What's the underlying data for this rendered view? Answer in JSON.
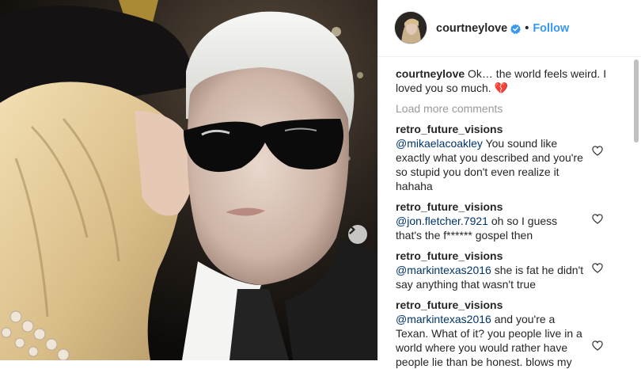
{
  "post": {
    "author": "courtneylove",
    "follow_label": "Follow",
    "separator": "•",
    "caption": {
      "user": "courtneylove",
      "text": "Ok… the world feels weird. I loved you so much.",
      "emoji": "💔"
    },
    "load_more_label": "Load more comments",
    "comments": [
      {
        "user": "retro_future_visions",
        "mention": "@mikaelacoakley",
        "text": "You sound like exactly what you described and you're so stupid you don't even realize it hahaha"
      },
      {
        "user": "retro_future_visions",
        "mention": "@jon.fletcher.7921",
        "text": "oh so I guess that's the f****** gospel then"
      },
      {
        "user": "retro_future_visions",
        "mention": "@markintexas2016",
        "text": "she is fat he didn't say anything that wasn't true"
      },
      {
        "user": "retro_future_visions",
        "mention": "@markintexas2016",
        "text": "and you're a Texan. What of it? you people live in a world where you would rather have people lie than be honest. blows my"
      }
    ]
  },
  "colors": {
    "accent": "#3897f0",
    "mention": "#003569",
    "muted": "#999999",
    "text": "#262626"
  },
  "icons": {
    "verified": "verified-badge-icon",
    "heart": "heart-outline-icon",
    "next": "chevron-right-icon"
  }
}
